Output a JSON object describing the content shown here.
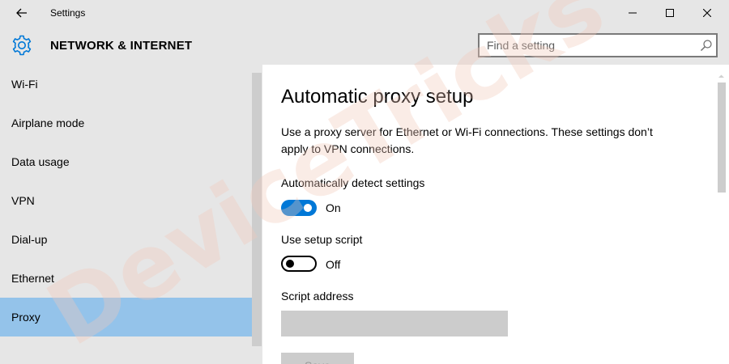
{
  "window": {
    "title": "Settings",
    "icons": {
      "back": "back-arrow-icon",
      "minimize": "minimize-icon",
      "maximize": "maximize-icon",
      "close": "close-icon"
    }
  },
  "header": {
    "section_title": "NETWORK & INTERNET",
    "section_icon": "gear-icon",
    "search_placeholder": "Find a setting",
    "search_value": ""
  },
  "sidebar": {
    "items": [
      {
        "label": "Wi-Fi",
        "active": false
      },
      {
        "label": "Airplane mode",
        "active": false
      },
      {
        "label": "Data usage",
        "active": false
      },
      {
        "label": "VPN",
        "active": false
      },
      {
        "label": "Dial-up",
        "active": false
      },
      {
        "label": "Ethernet",
        "active": false
      },
      {
        "label": "Proxy",
        "active": true
      }
    ]
  },
  "main": {
    "title": "Automatic proxy setup",
    "description": "Use a proxy server for Ethernet or Wi-Fi connections. These settings don’t apply to VPN connections.",
    "auto_detect": {
      "label": "Automatically detect settings",
      "state": "On"
    },
    "setup_script": {
      "label": "Use setup script",
      "state": "Off"
    },
    "script_address": {
      "label": "Script address",
      "value": ""
    },
    "save_label": "Save"
  },
  "watermark": {
    "text": "DeviceTricks"
  },
  "colors": {
    "accent": "#0078d7",
    "selected": "#94c3ea",
    "chrome": "#e6e6e6",
    "watermark": "#f2c9ba"
  }
}
